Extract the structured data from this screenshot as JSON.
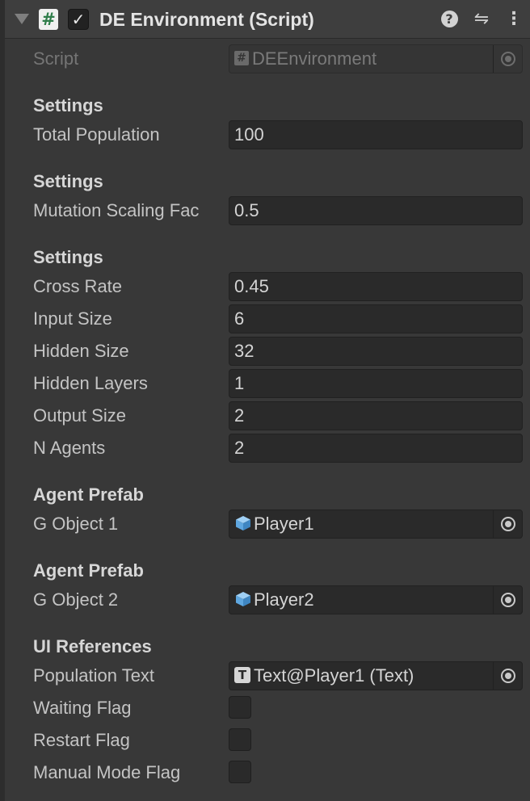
{
  "component": {
    "title": "DE Environment (Script)",
    "enabled": true,
    "icons": [
      "fold-arrow-icon",
      "script-icon",
      "help-icon",
      "preset-icon",
      "menu-icon"
    ]
  },
  "script_row": {
    "label": "Script",
    "value": "DEEnvironment"
  },
  "sections": {
    "s1": "Settings",
    "s2": "Settings",
    "s3": "Settings",
    "s4": "Agent Prefab",
    "s5": "Agent Prefab",
    "s6": "UI References"
  },
  "fields": {
    "total_population": {
      "label": "Total Population",
      "value": "100"
    },
    "mutation_scaling": {
      "label": "Mutation Scaling Fac",
      "value": "0.5"
    },
    "cross_rate": {
      "label": "Cross Rate",
      "value": "0.45"
    },
    "input_size": {
      "label": "Input Size",
      "value": "6"
    },
    "hidden_size": {
      "label": "Hidden Size",
      "value": "32"
    },
    "hidden_layers": {
      "label": "Hidden Layers",
      "value": "1"
    },
    "output_size": {
      "label": "Output Size",
      "value": "2"
    },
    "n_agents": {
      "label": "N Agents",
      "value": "2"
    },
    "g_object_1": {
      "label": "G Object 1",
      "value": "Player1"
    },
    "g_object_2": {
      "label": "G Object 2",
      "value": "Player2"
    },
    "population_text": {
      "label": "Population Text",
      "value": "Text@Player1 (Text)"
    },
    "waiting_flag": {
      "label": "Waiting Flag",
      "checked": false
    },
    "restart_flag": {
      "label": "Restart Flag",
      "checked": false
    },
    "manual_mode_flag": {
      "label": "Manual Mode Flag",
      "checked": false
    }
  },
  "colors": {
    "background": "#383838",
    "header": "#3e3e3e",
    "field": "#2a2a2a",
    "script_green": "#2f7d4a",
    "prefab_blue": "#5fa7e0"
  }
}
